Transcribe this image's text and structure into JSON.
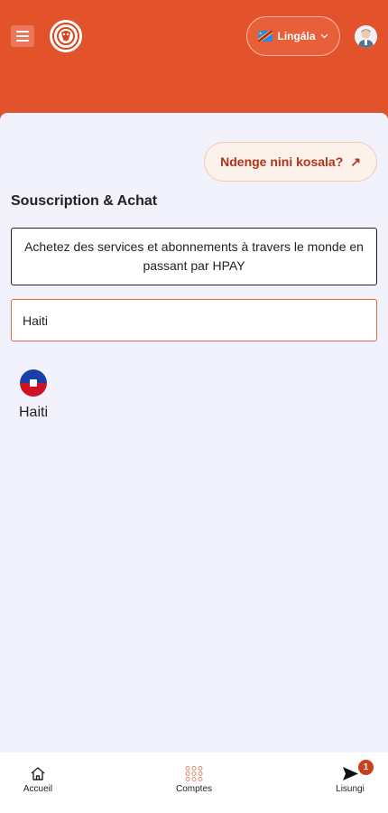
{
  "header": {
    "language_label": "Lingála",
    "icons": {
      "menu": "hamburger-icon",
      "logo": "brand-logo",
      "flag": "flag-drc",
      "dropdown": "chevron-down-icon",
      "avatar": "user-avatar"
    }
  },
  "main": {
    "help_label": "Ndenge nini kosala?",
    "help_icon": "↗",
    "title": "Souscription & Achat",
    "description": "Achetez des services et abonnements à travers le monde en passant par HPAY",
    "search_value": "Haiti",
    "countries": [
      {
        "name": "Haiti",
        "flag": "flag-haiti"
      }
    ]
  },
  "bottom_nav": {
    "items": [
      {
        "label": "Accueil",
        "icon": "home-icon"
      },
      {
        "label": "Comptes",
        "icon": "grid-icon"
      },
      {
        "label": "Lisungi",
        "icon": "send-icon",
        "badge": "1"
      }
    ]
  },
  "colors": {
    "brand": "#e2522b",
    "background": "#f1f2fb",
    "badge": "#c9401c",
    "help_text": "#b03418"
  }
}
